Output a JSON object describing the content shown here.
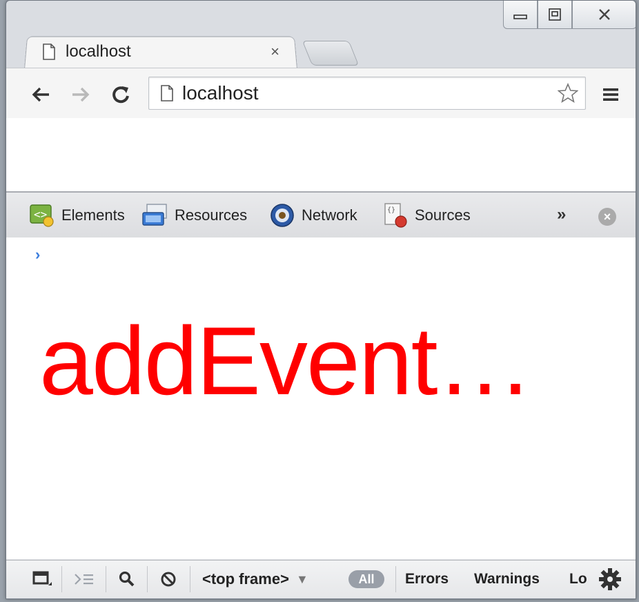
{
  "browser": {
    "tab": {
      "title": "localhost",
      "close_glyph": "×",
      "icon": "page-icon"
    },
    "window_controls": {
      "minimize": "minimize-icon",
      "restore": "restore-icon",
      "close": "close-icon"
    }
  },
  "toolbar": {
    "url": "localhost",
    "back": "back-arrow-icon",
    "forward": "forward-arrow-icon",
    "reload": "reload-icon",
    "star": "star-icon",
    "menu": "hamburger-menu-icon"
  },
  "devtools": {
    "tabs": [
      {
        "label": "Elements",
        "icon": "elements-icon"
      },
      {
        "label": "Resources",
        "icon": "resources-icon"
      },
      {
        "label": "Network",
        "icon": "network-icon"
      },
      {
        "label": "Sources",
        "icon": "sources-icon"
      }
    ],
    "more_label": "»",
    "close_label": "×",
    "console": {
      "prompt": "›",
      "overlay_text": "addEvent…"
    },
    "statusbar": {
      "frame": "<top frame>",
      "frame_arrow": "▼",
      "all_label": "All",
      "filters": [
        "Errors",
        "Warnings",
        "Lo"
      ]
    }
  },
  "colors": {
    "overlay": "#ff0000",
    "prompt": "#3b7ddd"
  }
}
